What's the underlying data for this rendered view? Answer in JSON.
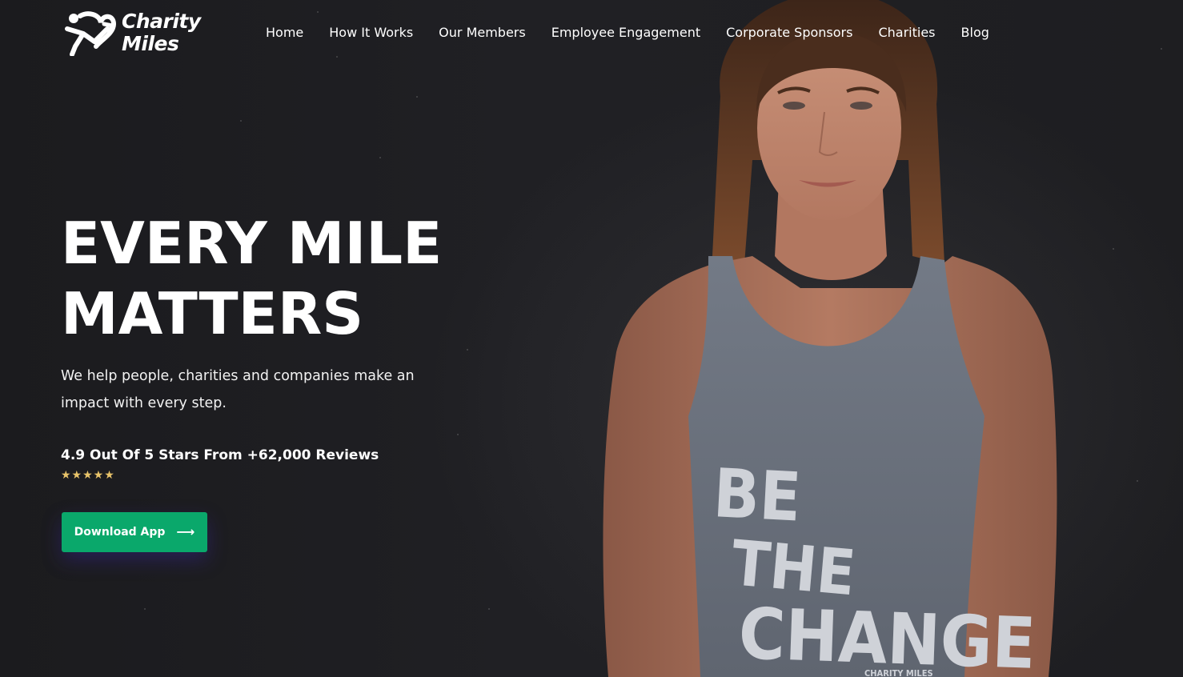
{
  "brand": {
    "line1": "Charity",
    "line2": "Miles"
  },
  "nav": {
    "items": [
      {
        "label": "Home"
      },
      {
        "label": "How It Works"
      },
      {
        "label": "Our Members"
      },
      {
        "label": "Employee Engagement"
      },
      {
        "label": "Corporate Sponsors"
      },
      {
        "label": "Charities"
      },
      {
        "label": "Blog"
      }
    ]
  },
  "hero": {
    "headline_line1": "EVERY MILE",
    "headline_line2": "MATTERS",
    "subtext": "We help people, charities and companies make an impact with every step.",
    "reviews": "4.9 Out Of 5 Stars From +62,000 Reviews",
    "stars": "★★★★★",
    "cta_label": "Download App",
    "cta_icon": "arrow-right-icon",
    "shirt_text": [
      "BE",
      "THE",
      "CHANGE"
    ],
    "shirt_brand": "CHARITY MILES"
  },
  "colors": {
    "background": "#1d1d1f",
    "accent": "#0aa86b",
    "star": "#e9c46a",
    "text": "#ffffff"
  }
}
